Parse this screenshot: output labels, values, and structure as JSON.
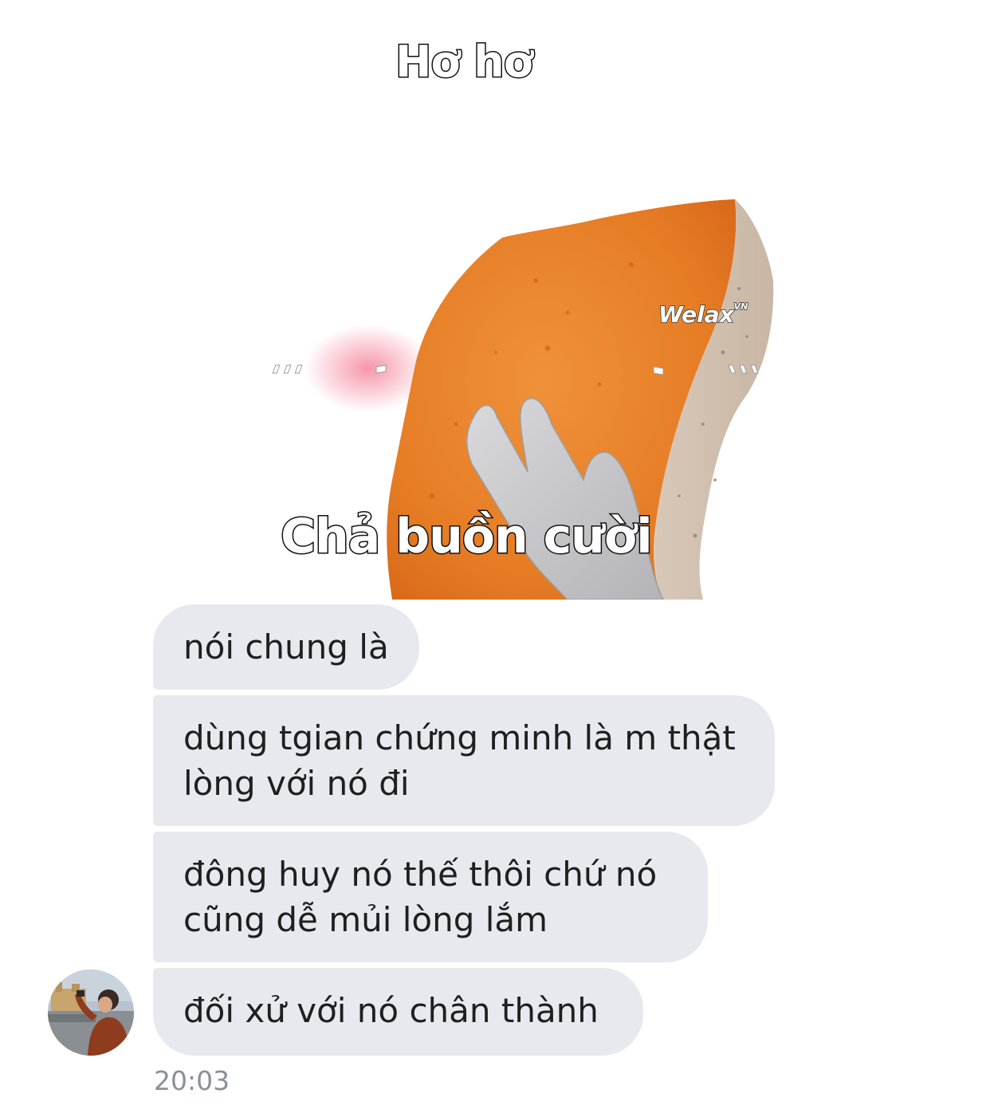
{
  "sticker": {
    "caption_top": "Hơ hơ",
    "caption_bottom": "Chả buồn cười",
    "watermark": "Welax",
    "watermark_sup": "VN"
  },
  "messages": [
    {
      "text": "nói chung là"
    },
    {
      "text": "dùng tgian chứng minh là m thật\nlòng với nó đi"
    },
    {
      "text": "đông huy nó thế thôi chứ nó\ncũng dễ mủi lòng lắm"
    },
    {
      "text": "đối xử với nó chân thành"
    }
  ],
  "timestamp": "20:03",
  "colors": {
    "bubble": "#e8e9ee",
    "text": "#1f1f1f",
    "timestamp": "#8b8f99"
  }
}
